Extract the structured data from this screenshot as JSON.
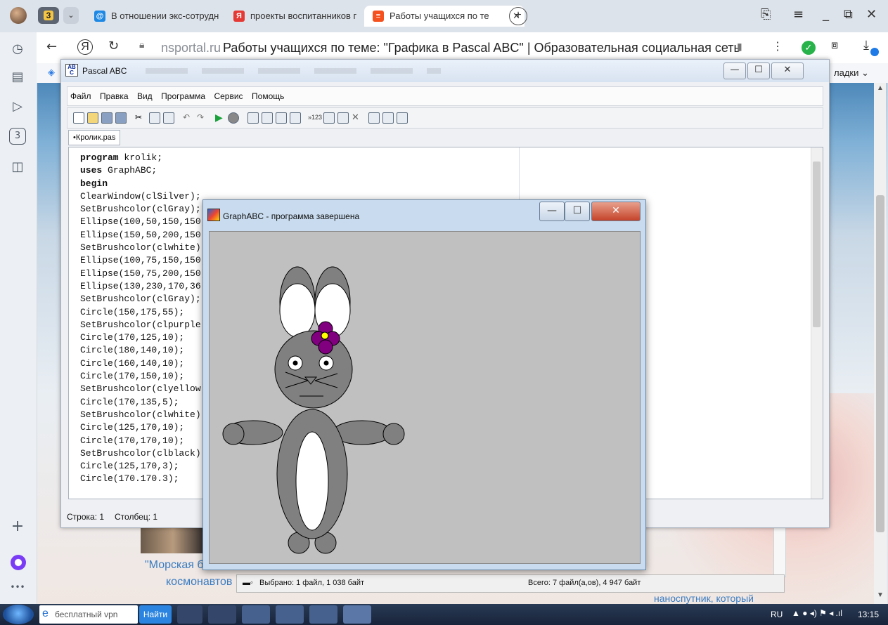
{
  "browser": {
    "tabs": [
      {
        "label": "В отношении экс-сотрудн",
        "favicon_color": "#1e88e5",
        "favicon_glyph": "@"
      },
      {
        "label": "проекты воспитанников г",
        "favicon_color": "#e53935",
        "favicon_glyph": "Я"
      },
      {
        "label": "Работы учащихся по те",
        "favicon_color": "#f4511e",
        "favicon_glyph": "≡",
        "active": true
      }
    ],
    "tab_counter": "3",
    "url_host": "nsportal.ru",
    "page_title": "Работы учащихся по теме: \"Графика в Pascal ABC\" | Образовательная социальная сеть",
    "bookmarks_tail": "ладки",
    "sidebar_badge": "3"
  },
  "background_page": {
    "caption_line1": "\"Морская б",
    "caption_line2": "космонавтов",
    "bottom_right_link": "наноспутник, который"
  },
  "pascal": {
    "title": "Pascal ABC",
    "title_icon": "AB C",
    "menu": [
      "Файл",
      "Правка",
      "Вид",
      "Программа",
      "Сервис",
      "Помощь"
    ],
    "file_tab": "•Кролик.pas",
    "code_lines": [
      "program krolik;",
      "uses GraphABC;",
      "begin",
      "ClearWindow(clSilver);",
      "SetBrushcolor(clGray);",
      "Ellipse(100,50,150,150)",
      "Ellipse(150,50,200,150)",
      "SetBrushcolor(clwhite)",
      "Ellipse(100,75,150,150)",
      "Ellipse(150,75,200,150)",
      "Ellipse(130,230,170,36",
      "SetBrushcolor(clGray);",
      "Circle(150,175,55);",
      "SetBrushcolor(clpurple)",
      "Circle(170,125,10);",
      "Circle(180,140,10);",
      "Circle(160,140,10);",
      "Circle(170,150,10);",
      "SetBrushcolor(clyellow)",
      "Circle(170,135,5);",
      "SetBrushcolor(clwhite)",
      "Circle(125,170,10);",
      "Circle(170,170,10);",
      "SetBrushcolor(clblack)",
      "Circle(125,170,3);",
      "Circle(170.170.3);"
    ],
    "status_row": "Строка: 1",
    "status_col": "Столбец: 1"
  },
  "graph_window": {
    "title": "GraphABC - программа завершена",
    "canvas_color": "#c0c0c0"
  },
  "file_manager": {
    "selected": "Выбрано: 1 файл, 1 038 байт",
    "total": "Всего: 7 файл(а,ов), 4 947 байт"
  },
  "taskbar": {
    "search_text": "бесплатный vpn",
    "find_button": "Найти",
    "language": "RU",
    "clock": "13:15"
  }
}
